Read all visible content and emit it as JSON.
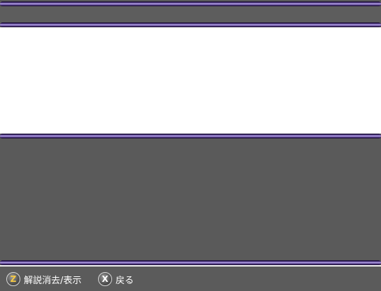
{
  "footer": {
    "hints": [
      {
        "key": "Z",
        "label": "解説消去/表示"
      },
      {
        "key": "X",
        "label": "戻る"
      }
    ]
  },
  "colors": {
    "background": "#5a5a5a",
    "panel": "#ffffff",
    "frame_accent": "#b9a6ee",
    "key_z": "#f5c842",
    "key_x": "#ffffff"
  }
}
